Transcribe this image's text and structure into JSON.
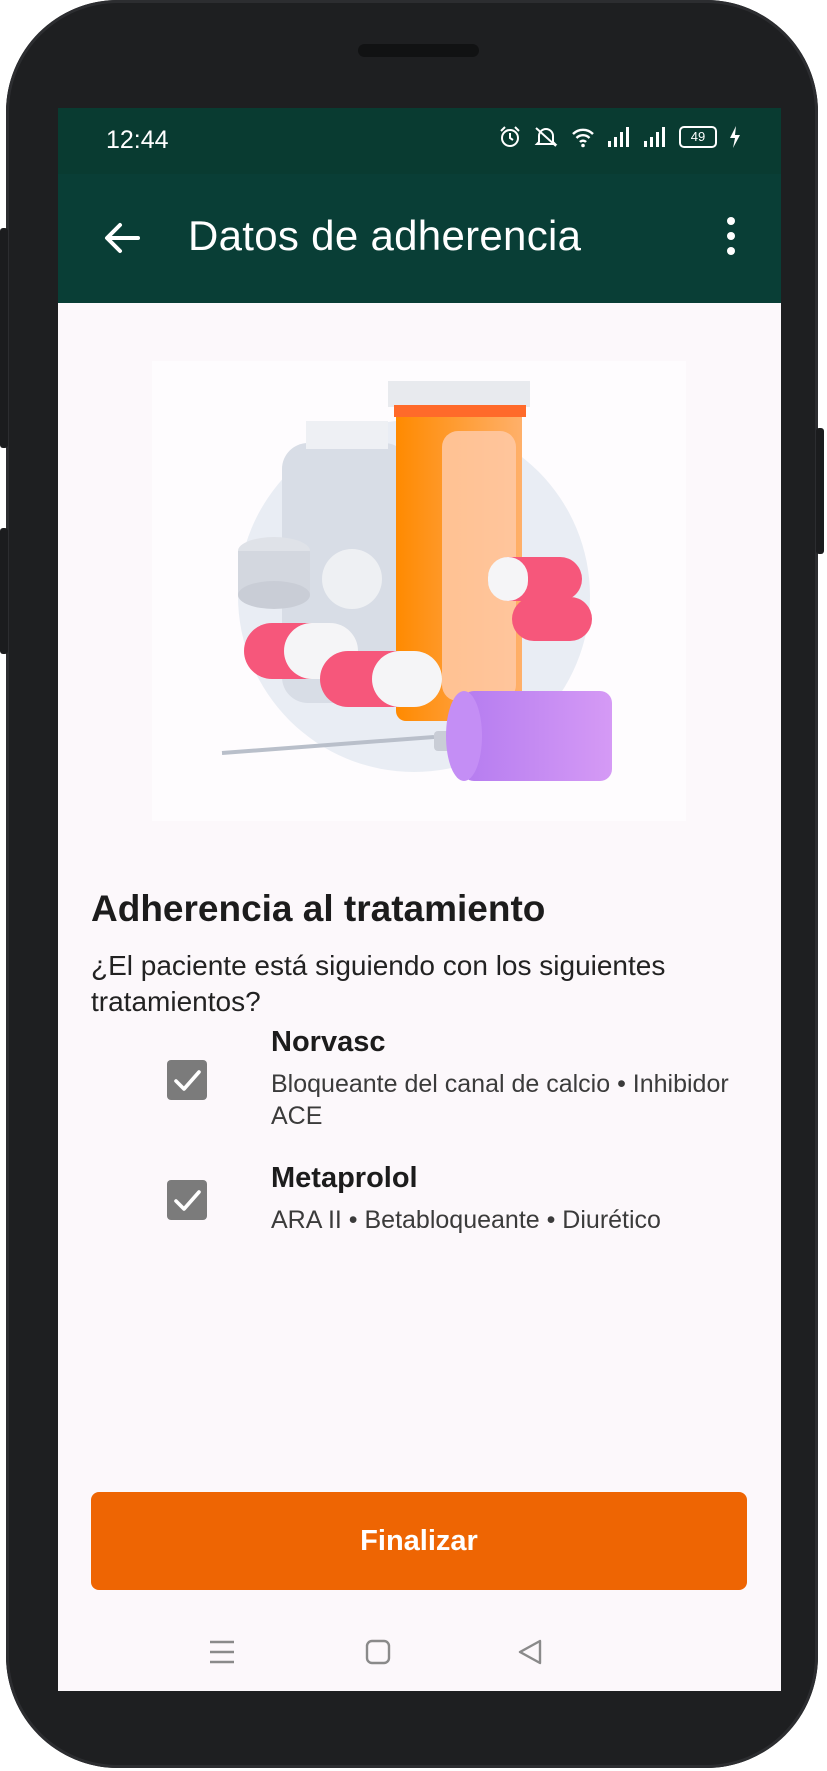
{
  "status_bar": {
    "time": "12:44",
    "battery": "49",
    "icons": [
      "alarm-icon",
      "mute-icon",
      "wifi-icon",
      "signal-icon",
      "signal-icon",
      "battery-icon",
      "charging-icon"
    ]
  },
  "app_bar": {
    "title": "Datos de adherencia",
    "back_icon": "arrow-left-icon",
    "more_icon": "more-vert-icon"
  },
  "colors": {
    "status_bar": "#093b31",
    "app_bar": "#093e36",
    "background": "#fcf8fb",
    "primary_button": "#ee6503",
    "checkbox": "#7b7b7b"
  },
  "section": {
    "title": "Adherencia al tratamiento",
    "question": "¿El paciente está siguiendo con los siguientes tratamientos?"
  },
  "treatments": [
    {
      "name": "Norvasc",
      "description": "Bloqueante del canal de calcio • Inhibidor ACE",
      "checked": true
    },
    {
      "name": "Metaprolol",
      "description": "ARA II • Betabloqueante • Diurético",
      "checked": true
    }
  ],
  "actions": {
    "finish_label": "Finalizar"
  },
  "nav_bar": {
    "icons": [
      "menu-icon",
      "home-icon",
      "back-triangle-icon"
    ]
  }
}
